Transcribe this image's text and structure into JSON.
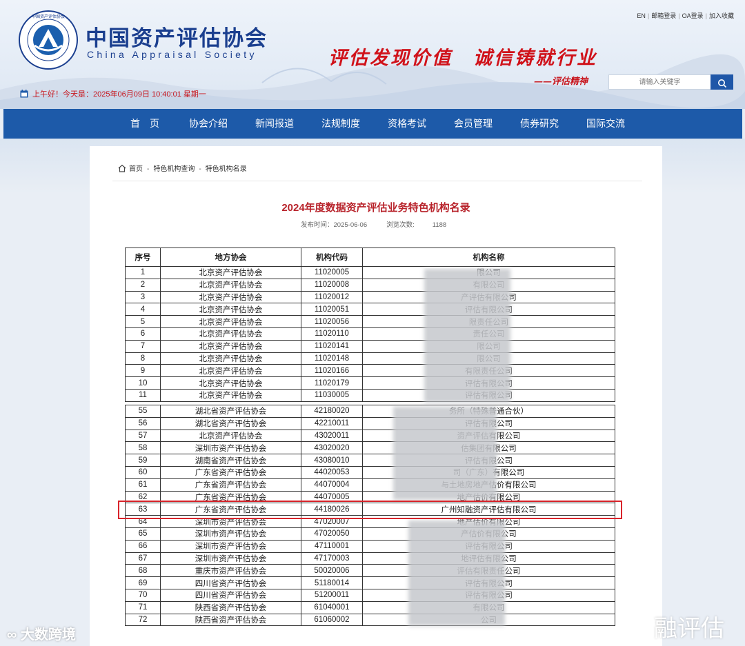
{
  "site": {
    "name_cn": "中国资产评估协会",
    "name_en": "China Appraisal Society",
    "logo_ring_text": "China Appraisal Society",
    "slogan": "评估发现价值　诚信铸就行业",
    "slogan_sub": "——评估精神",
    "top_links": [
      "EN",
      "邮箱登录",
      "OA登录",
      "加入收藏"
    ],
    "search_placeholder": "请输入关键字",
    "greeting": "上午好！今天是：2025年06月09日 10:40:01 星期一",
    "colors": {
      "brand_blue": "#1d5aa9",
      "accent_red": "#d0121a",
      "title_red": "#b8232b"
    }
  },
  "nav": [
    "首　页",
    "协会介绍",
    "新闻报道",
    "法规制度",
    "资格考试",
    "会员管理",
    "债券研究",
    "国际交流"
  ],
  "breadcrumb": [
    "首页",
    "特色机构查询",
    "特色机构名录"
  ],
  "article": {
    "title": "2024年度数据资产评估业务特色机构名录",
    "published_label": "发布时间：",
    "published": "2025-06-06",
    "views_label": "浏览次数:",
    "views": "1188"
  },
  "table": {
    "headers": [
      "序号",
      "地方协会",
      "机构代码",
      "机构名称"
    ],
    "rows_top": [
      [
        "1",
        "北京资产评估协会",
        "11020005",
        "限公司"
      ],
      [
        "2",
        "北京资产评估协会",
        "11020008",
        "有限公司"
      ],
      [
        "3",
        "北京资产评估协会",
        "11020012",
        "产评估有限公司"
      ],
      [
        "4",
        "北京资产评估协会",
        "11020051",
        "评估有限公司"
      ],
      [
        "5",
        "北京资产评估协会",
        "11020056",
        "限责任公司"
      ],
      [
        "6",
        "北京资产评估协会",
        "11020110",
        "责任公司"
      ],
      [
        "7",
        "北京资产评估协会",
        "11020141",
        "限公司"
      ],
      [
        "8",
        "北京资产评估协会",
        "11020148",
        "限公司"
      ],
      [
        "9",
        "北京资产评估协会",
        "11020166",
        "有限责任公司"
      ],
      [
        "10",
        "北京资产评估协会",
        "11020179",
        "评估有限公司"
      ],
      [
        "11",
        "北京资产评估协会",
        "11030005",
        "评估有限公司"
      ]
    ],
    "rows_bottom": [
      [
        "55",
        "湖北省资产评估协会",
        "42180020",
        "务所（特殊普通合伙）"
      ],
      [
        "56",
        "湖北省资产评估协会",
        "42210011",
        "评估有限公司"
      ],
      [
        "57",
        "北京资产评估协会",
        "43020011",
        "资产评估有限公司"
      ],
      [
        "58",
        "深圳市资产评估协会",
        "43020020",
        "估集团有限公司"
      ],
      [
        "59",
        "湖南省资产评估协会",
        "43080010",
        "评估有限公司"
      ],
      [
        "60",
        "广东省资产评估协会",
        "44020053",
        "司（广东）有限公司"
      ],
      [
        "61",
        "广东省资产评估协会",
        "44070004",
        "与土地房地产估价有限公司"
      ],
      [
        "62",
        "广东省资产评估协会",
        "44070005",
        "地产估价有限公司"
      ],
      [
        "63",
        "广东省资产评估协会",
        "44180026",
        "广州知融资产评估有限公司"
      ],
      [
        "64",
        "深圳市资产评估协会",
        "47020007",
        "地产估价有限公司"
      ],
      [
        "65",
        "深圳市资产评估协会",
        "47020050",
        "产估价有限公司"
      ],
      [
        "66",
        "深圳市资产评估协会",
        "47110001",
        "评估有限公司"
      ],
      [
        "67",
        "深圳市资产评估协会",
        "47170003",
        "地评估有限公司"
      ],
      [
        "68",
        "重庆市资产评估协会",
        "50020006",
        "评估有限责任公司"
      ],
      [
        "69",
        "四川省资产评估协会",
        "51180014",
        "评估有限公司"
      ],
      [
        "70",
        "四川省资产评估协会",
        "51200011",
        "评估有限公司"
      ],
      [
        "71",
        "陕西省资产评估协会",
        "61040001",
        "有限公司"
      ],
      [
        "72",
        "陕西省资产评估协会",
        "61060002",
        "公司"
      ]
    ]
  },
  "watermark": {
    "left": "大数跨境",
    "right": "融评估"
  }
}
